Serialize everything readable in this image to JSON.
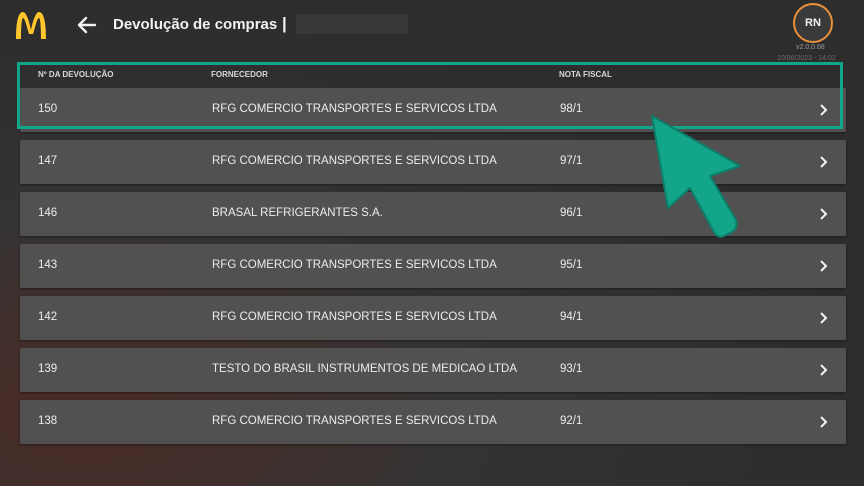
{
  "header": {
    "title": "Devolução de compras",
    "separator": "|",
    "avatar_initials": "RN",
    "version": "v2.0.0.68",
    "datetime": "10/08/2023 - 14:02"
  },
  "table": {
    "columns": [
      "Nº DA DEVOLUÇÃO",
      "FORNECEDOR",
      "NOTA FISCAL"
    ],
    "rows": [
      {
        "id": "150",
        "supplier": "RFG COMERCIO TRANSPORTES E SERVICOS LTDA",
        "invoice": "98/1"
      },
      {
        "id": "147",
        "supplier": "RFG COMERCIO TRANSPORTES E SERVICOS LTDA",
        "invoice": "97/1"
      },
      {
        "id": "146",
        "supplier": "BRASAL REFRIGERANTES S.A.",
        "invoice": "96/1"
      },
      {
        "id": "143",
        "supplier": "RFG COMERCIO TRANSPORTES E SERVICOS LTDA",
        "invoice": "95/1"
      },
      {
        "id": "142",
        "supplier": "RFG COMERCIO TRANSPORTES E SERVICOS LTDA",
        "invoice": "94/1"
      },
      {
        "id": "139",
        "supplier": "TESTO DO BRASIL INSTRUMENTOS DE MEDICAO LTDA",
        "invoice": "93/1"
      },
      {
        "id": "138",
        "supplier": "RFG COMERCIO TRANSPORTES E SERVICOS LTDA",
        "invoice": "92/1"
      }
    ]
  },
  "colors": {
    "accent_highlight": "#12a58a",
    "avatar_ring": "#e8913a",
    "logo_yellow": "#ffc72c",
    "row_bg": "#515151"
  },
  "icons": {
    "logo": "mcdonalds-logo",
    "back": "arrow-left-icon",
    "row_action": "chevron-right-icon",
    "pointer": "pointer-arrow-icon"
  }
}
